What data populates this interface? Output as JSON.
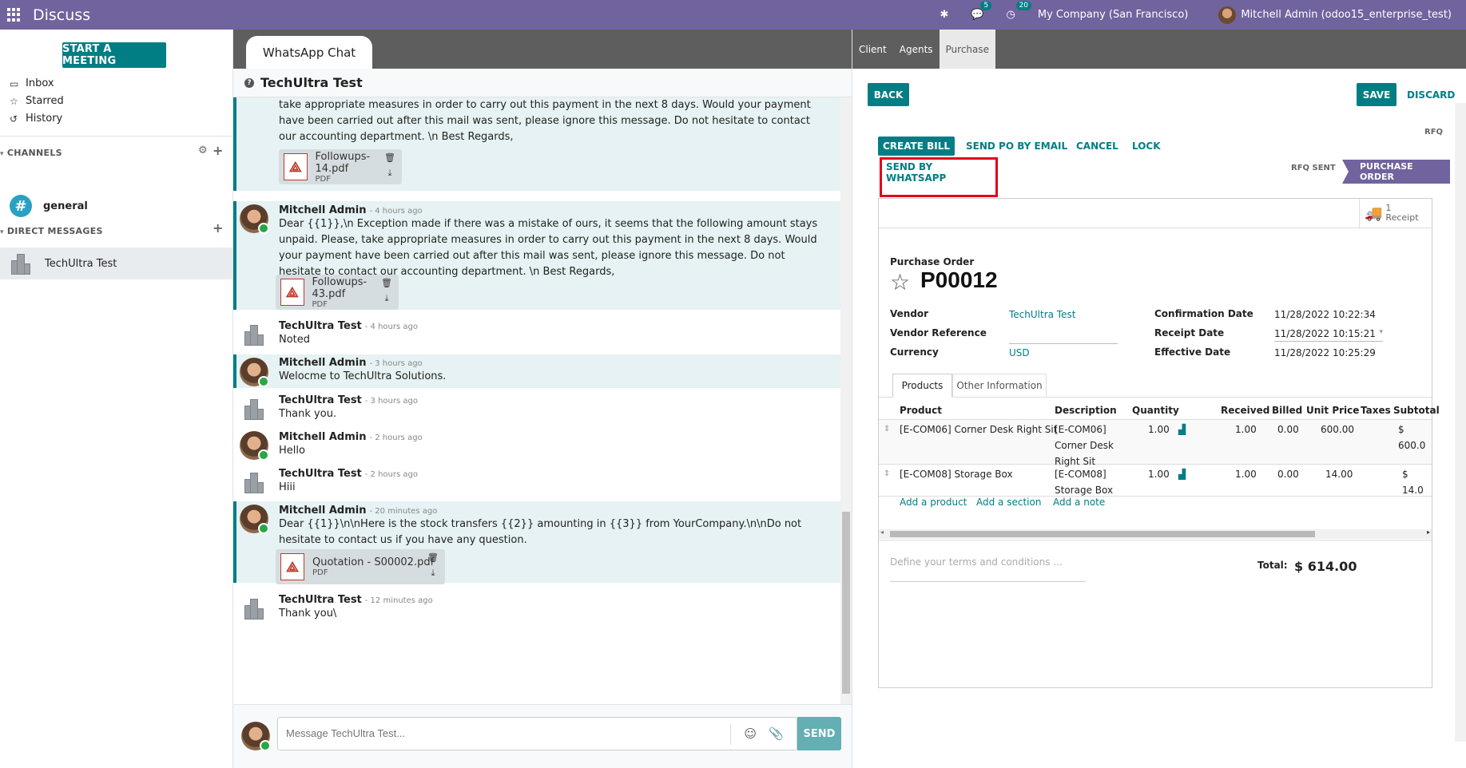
{
  "topbar": {
    "app_title": "Discuss",
    "activity_badge": "5",
    "messages_badge": "20",
    "company": "My Company (San Francisco)",
    "user": "Mitchell Admin (odoo15_enterprise_test)"
  },
  "sidebar": {
    "start_meeting": "START A MEETING",
    "mailboxes": [
      {
        "label": "Inbox",
        "icon": "inbox-icon"
      },
      {
        "label": "Starred",
        "icon": "star-icon"
      },
      {
        "label": "History",
        "icon": "history-icon"
      }
    ],
    "channels_title": "CHANNELS",
    "channel_general": "general",
    "dm_title": "DIRECT MESSAGES",
    "dm_user": "TechUltra Test"
  },
  "chat": {
    "tab_label": "WhatsApp Chat",
    "header_title": "TechUltra Test",
    "messages": [
      {
        "author": "",
        "date": "",
        "text": "take appropriate measures in order to carry out this payment in the next 8 days. Would your payment have been carried out after this mail was sent, please ignore this message. Do not hesitate to contact our accounting department. \\n Best Regards,",
        "attachment": "Followups-14.pdf",
        "ext": "PDF"
      },
      {
        "author": "Mitchell Admin",
        "date": "- 4 hours ago",
        "text": "Dear {{1}},\\n Exception made if there was a mistake of ours, it seems that the following amount stays unpaid. Please, take appropriate measures in order to carry out this payment in the next 8 days. Would your payment have been carried out after this mail was sent, please ignore this message. Do not hesitate to contact our accounting department. \\n Best Regards,",
        "attachment": "Followups-43.pdf",
        "ext": "PDF"
      },
      {
        "author": "TechUltra Test",
        "date": "- 4 hours ago",
        "text": "Noted"
      },
      {
        "author": "Mitchell Admin",
        "date": "- 3 hours ago",
        "text": "Welocme to TechUltra Solutions."
      },
      {
        "author": "TechUltra Test",
        "date": "- 3 hours ago",
        "text": "Thank you."
      },
      {
        "author": "Mitchell Admin",
        "date": "- 2 hours ago",
        "text": "Hello"
      },
      {
        "author": "TechUltra Test",
        "date": "- 2 hours ago",
        "text": "Hiii"
      },
      {
        "author": "Mitchell Admin",
        "date": "- 20 minutes ago",
        "text": "Dear {{1}}\\n\\nHere is the stock transfers {{2}} amounting in {{3}} from YourCompany.\\n\\nDo not hesitate to contact us if you have any question.",
        "attachment": "Quotation - S00002.pdf",
        "ext": "PDF"
      },
      {
        "author": "TechUltra Test",
        "date": "- 12 minutes ago",
        "text": "Thank you\\"
      }
    ],
    "composer_placeholder": "Message TechUltra Test...",
    "send_label": "SEND"
  },
  "panel": {
    "tabs": [
      "Client",
      "Agents",
      "Purchase"
    ],
    "back": "BACK",
    "save": "SAVE",
    "discard": "DISCARD",
    "actions": [
      "CREATE BILL",
      "SEND PO BY EMAIL",
      "CANCEL",
      "LOCK"
    ],
    "send_whatsapp": "SEND BY WHATSAPP",
    "stages": [
      "RFQ",
      "RFQ SENT",
      "PURCHASE ORDER"
    ],
    "receipt_count": "1",
    "receipt_label": "Receipt",
    "doc_type": "Purchase Order",
    "doc_name": "P00012",
    "fields": {
      "vendor_label": "Vendor",
      "vendor": "TechUltra Test",
      "vendor_ref_label": "Vendor Reference",
      "vendor_ref": "",
      "currency_label": "Currency",
      "currency": "USD",
      "confirm_label": "Confirmation Date",
      "confirm": "11/28/2022 10:22:34",
      "receipt_label": "Receipt Date",
      "receipt": "11/28/2022 10:15:21",
      "effective_label": "Effective Date",
      "effective": "11/28/2022 10:25:29"
    },
    "notebook_tabs": [
      "Products",
      "Other Information"
    ],
    "columns": [
      "Product",
      "Description",
      "Quantity",
      "Received",
      "Billed",
      "Unit Price",
      "Taxes",
      "Subtotal"
    ],
    "lines": [
      {
        "product": "[E-COM06] Corner Desk Right Sit",
        "description": [
          "[E-COM06]",
          "Corner Desk",
          "Right Sit"
        ],
        "qty": "1.00",
        "received": "1.00",
        "billed": "0.00",
        "price": "600.00",
        "taxes": "",
        "subtotal": "$ 600.0"
      },
      {
        "product": "[E-COM08] Storage Box",
        "description": [
          "[E-COM08]",
          "Storage Box"
        ],
        "qty": "1.00",
        "received": "1.00",
        "billed": "0.00",
        "price": "14.00",
        "taxes": "",
        "subtotal": "$ 14.0"
      }
    ],
    "add_links": [
      "Add a product",
      "Add a section",
      "Add a note"
    ],
    "terms_placeholder": "Define your terms and conditions ...",
    "total_label": "Total:",
    "total": "$ 614.00"
  }
}
